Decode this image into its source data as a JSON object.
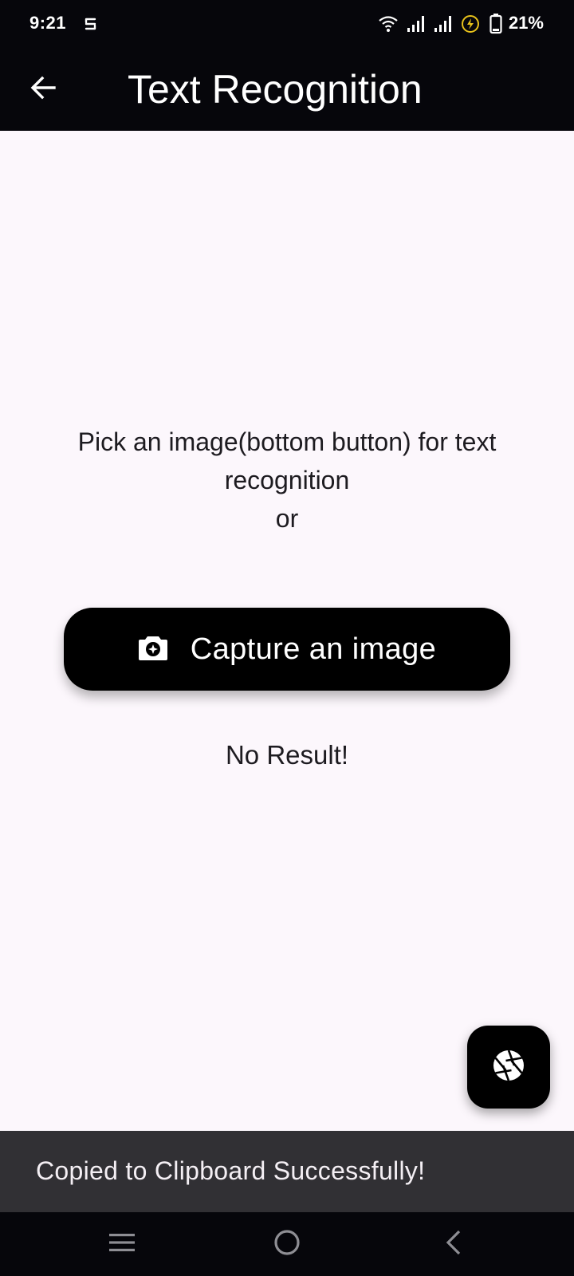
{
  "status_bar": {
    "time": "9:21",
    "battery_percent": "21%",
    "icons": [
      "sync-icon",
      "wifi-icon",
      "signal-icon",
      "signal-icon",
      "charging-icon",
      "battery-icon"
    ]
  },
  "app_bar": {
    "title": "Text Recognition",
    "back_icon": "arrow-back-icon"
  },
  "main": {
    "instruction_line1": "Pick an image(bottom button) for text",
    "instruction_line2": "recognition",
    "instruction_line3": "or",
    "capture_button_label": "Capture an image",
    "capture_button_icon": "camera-icon",
    "result_text": "No Result!"
  },
  "fab": {
    "icon": "camera-shutter-icon"
  },
  "snackbar": {
    "message": "Copied to Clipboard Successfully!"
  },
  "nav_bar": {
    "icons": [
      "menu-icon",
      "home-icon",
      "back-icon"
    ]
  },
  "colors": {
    "app_bar": "#06060b",
    "background": "#fcf7fc",
    "button": "#000000",
    "snackbar": "#313034",
    "charging_accent": "#e8c21b"
  }
}
